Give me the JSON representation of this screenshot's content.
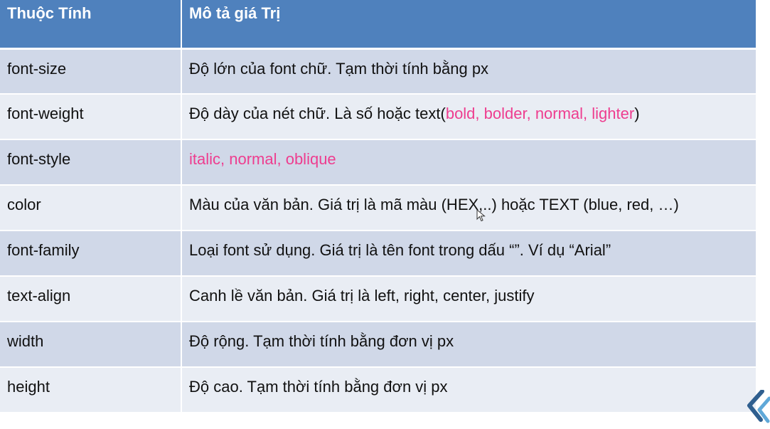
{
  "table": {
    "headers": [
      "Thuộc Tính",
      "Mô tả giá Trị"
    ],
    "rows": [
      {
        "name": "font-size",
        "desc": "Độ lớn của font chữ. Tạm thời tính bằng px"
      },
      {
        "name": "font-weight",
        "desc_prefix": "Độ dày của nét chữ. Là số hoặc text(",
        "desc_highlight": "bold, bolder, normal, lighter",
        "desc_suffix": ")"
      },
      {
        "name": "font-style",
        "desc_highlight": "italic, normal, oblique"
      },
      {
        "name": "color",
        "desc": "Màu của văn bản. Giá trị là mã màu (HEX,..) hoặc TEXT (blue, red, …)"
      },
      {
        "name": "font-family",
        "desc": "Loại font sử dụng. Giá trị là tên font trong dấu “”. Ví dụ “Arial”"
      },
      {
        "name": "text-align",
        "desc": "Canh lề văn bản. Giá trị là left, right, center, justify"
      },
      {
        "name": "width",
        "desc": "Độ rộng. Tạm thời tính bằng đơn vị px"
      },
      {
        "name": "height",
        "desc": "Độ cao. Tạm thời tính bằng đơn vị px"
      }
    ]
  },
  "colors": {
    "header_bg": "#4f81bd",
    "row_dark": "#d0d8e8",
    "row_light": "#e9edf4",
    "highlight": "#ee3d8f"
  },
  "icons": {
    "cursor": "mouse-pointer-icon",
    "logo": "chevron-logo-icon"
  }
}
